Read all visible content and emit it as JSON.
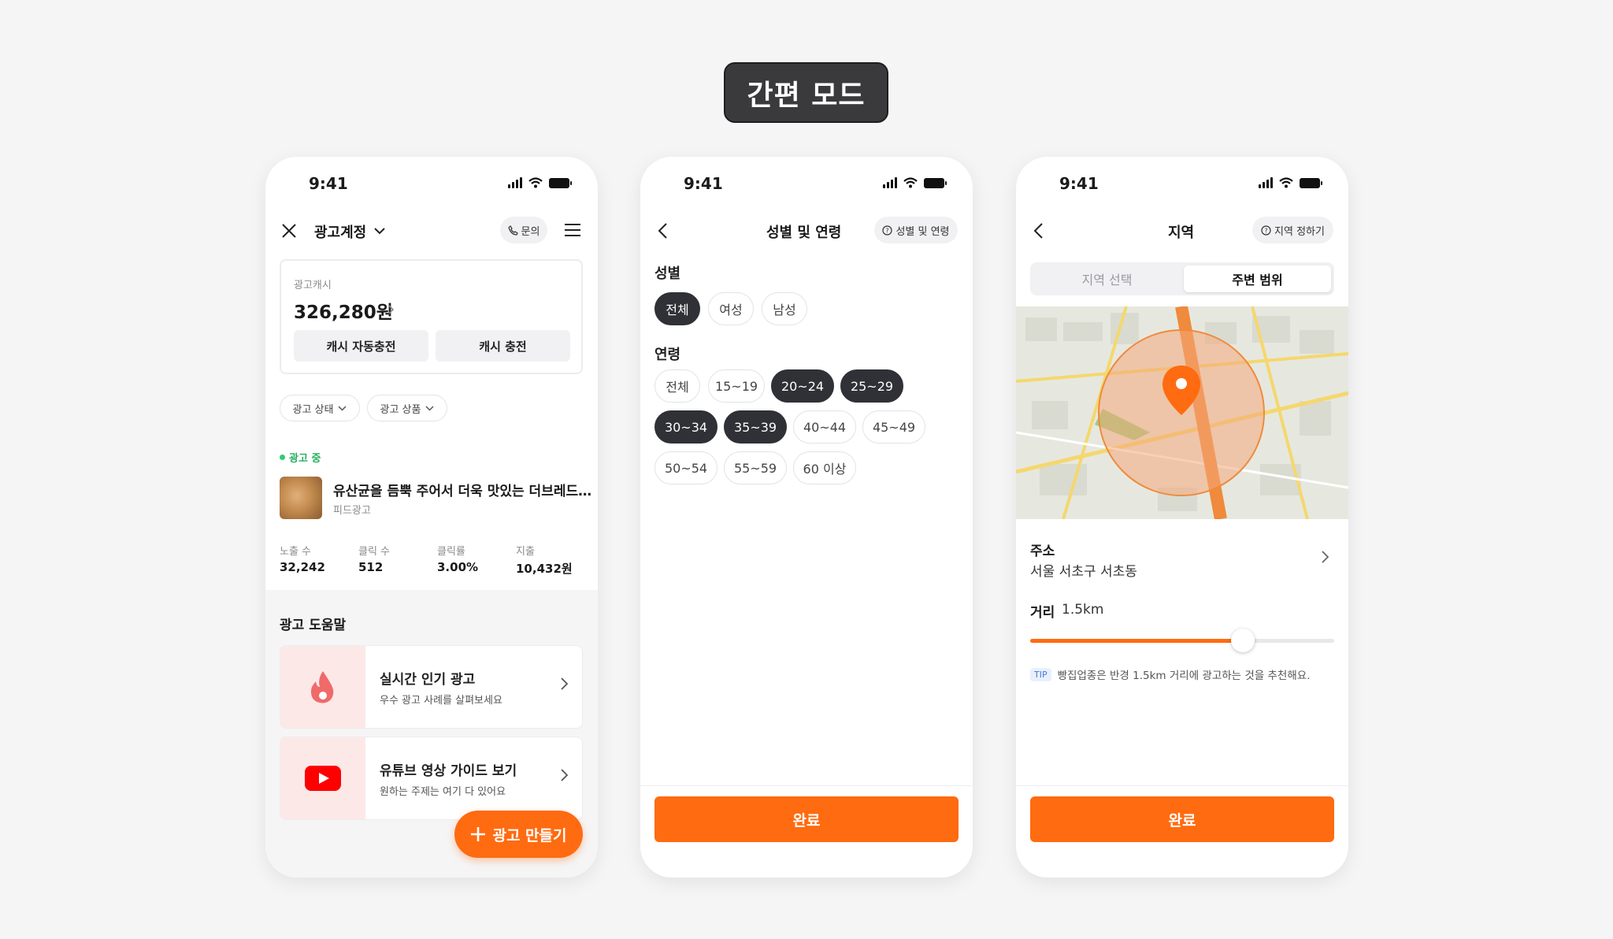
{
  "header": {
    "title": "간편 모드"
  },
  "status": {
    "time": "9:41"
  },
  "screen1": {
    "nav_title": "광고계정",
    "inquiry_label": "문의",
    "cash_label": "광고캐시",
    "cash_value": "326,280원",
    "auto_charge": "캐시 자동충전",
    "charge": "캐시 충전",
    "filter_status": "광고 상태",
    "filter_product": "광고 상품",
    "ad_state": "광고 중",
    "ad_title": "유산균을 듬뿍 주어서 더욱 맛있는 더브레드…",
    "ad_type": "피드광고",
    "stats": [
      {
        "label": "노출 수",
        "value": "32,242"
      },
      {
        "label": "클릭 수",
        "value": "512"
      },
      {
        "label": "클릭률",
        "value": "3.00%"
      },
      {
        "label": "지출",
        "value": "10,432원"
      }
    ],
    "help_title": "광고 도움말",
    "help_cards": [
      {
        "title": "실시간 인기 광고",
        "desc": "우수 광고 사례를 살펴보세요",
        "icon": "fire-icon"
      },
      {
        "title": "유튜브 영상 가이드 보기",
        "desc": "원하는 주제는 여기 다 있어요",
        "icon": "youtube-icon"
      }
    ],
    "fab_label": "광고 만들기"
  },
  "screen2": {
    "nav_title": "성별 및 연령",
    "help_chip": "성별 및 연령",
    "gender_label": "성별",
    "genders": [
      {
        "label": "전체",
        "selected": true
      },
      {
        "label": "여성",
        "selected": false
      },
      {
        "label": "남성",
        "selected": false
      }
    ],
    "age_label": "연령",
    "ages": [
      {
        "label": "전체",
        "selected": false
      },
      {
        "label": "15~19",
        "selected": false
      },
      {
        "label": "20~24",
        "selected": true
      },
      {
        "label": "25~29",
        "selected": true
      },
      {
        "label": "30~34",
        "selected": true
      },
      {
        "label": "35~39",
        "selected": true
      },
      {
        "label": "40~44",
        "selected": false
      },
      {
        "label": "45~49",
        "selected": false
      },
      {
        "label": "50~54",
        "selected": false
      },
      {
        "label": "55~59",
        "selected": false
      },
      {
        "label": "60 이상",
        "selected": false
      }
    ],
    "done": "완료"
  },
  "screen3": {
    "nav_title": "지역",
    "help_chip": "지역 정하기",
    "tab_select": "지역 선택",
    "tab_range": "주변 범위",
    "active_tab": "주변 범위",
    "address_label": "주소",
    "address_value": "서울 서초구 서초동",
    "distance_label": "거리",
    "distance_value": "1.5km",
    "distance_fill": 0.7,
    "tip_badge": "TIP",
    "tip_text": "빵집업종은 반경 1.5km 거리에 광고하는 것을 추천해요.",
    "done": "완료"
  },
  "colors": {
    "accent": "#ff6b10",
    "selected": "#2f3136",
    "status_green": "#2ecc71"
  }
}
